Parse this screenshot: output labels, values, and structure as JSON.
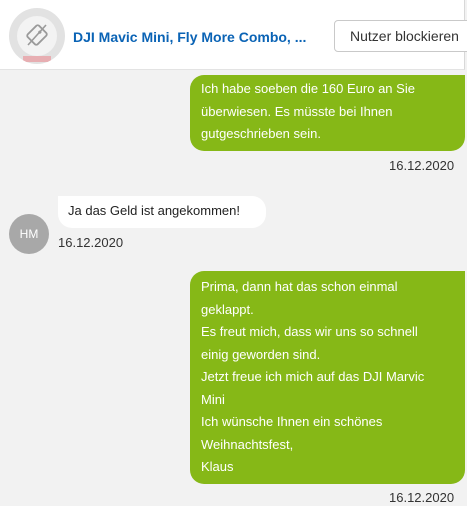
{
  "header": {
    "item_title": "DJI Mavic Mini, Fly More Combo, ...",
    "block_button_label": "Nutzer blockieren"
  },
  "messages": [
    {
      "direction": "outgoing",
      "lines": [
        "Ich habe soeben die 160 Euro an Sie",
        "überwiesen. Es müsste bei Ihnen",
        "gutgeschrieben sein."
      ],
      "date": "16.12.2020"
    },
    {
      "direction": "incoming",
      "sender_initials": "HM",
      "lines": [
        "Ja das Geld ist angekommen!"
      ],
      "date": "16.12.2020"
    },
    {
      "direction": "outgoing",
      "lines": [
        "Prima, dann hat das schon einmal",
        "geklappt.",
        "Es freut mich, dass wir uns so schnell",
        "einig geworden sind.",
        "Jetzt freue ich mich auf das DJI Marvic",
        "Mini",
        "Ich wünsche Ihnen ein schönes",
        "Weihnachtsfest,",
        "Klaus"
      ],
      "date": "16.12.2020"
    }
  ],
  "colors": {
    "outgoing_bubble": "#86b817",
    "incoming_bubble": "#ffffff",
    "background": "#f2f2f2",
    "title_link": "#0a63b5",
    "avatar_gray": "#a8a8a8"
  }
}
